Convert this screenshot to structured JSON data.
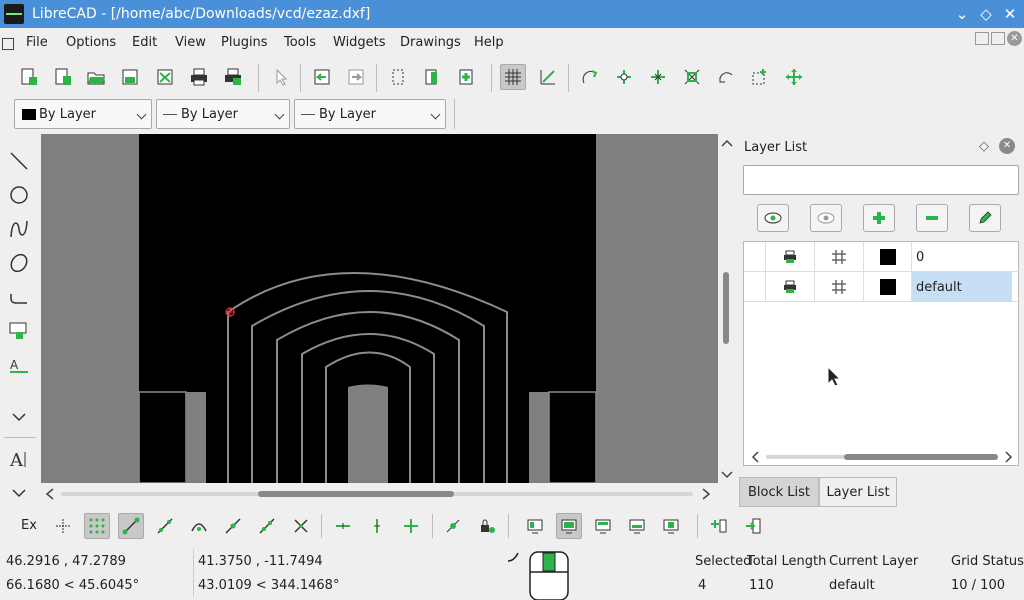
{
  "window": {
    "title": "LibreCAD - [/home/abc/Downloads/vcd/ezaz.dxf]"
  },
  "menu": [
    "File",
    "Options",
    "Edit",
    "View",
    "Plugins",
    "Tools",
    "Widgets",
    "Drawings",
    "Help"
  ],
  "pen_toolbar": {
    "color": "By Layer",
    "line_type": "By Layer",
    "line_width": "By Layer"
  },
  "layer_panel": {
    "title": "Layer List",
    "filter_value": "",
    "layers": [
      {
        "name": "0",
        "color": "#000000",
        "active": false
      },
      {
        "name": "default",
        "color": "#000000",
        "active": true
      }
    ]
  },
  "dock_tabs": [
    "Block List",
    "Layer List"
  ],
  "snap_toolbar": {
    "ex_label": "Ex"
  },
  "status": {
    "abs_coord": "46.2916 , 47.2789",
    "abs_polar": "66.1680 < 45.6045°",
    "rel_coord": "41.3750 , -11.7494",
    "rel_polar": "43.0109 < 344.1468°",
    "selected_label": "Selected",
    "selected_value": "4",
    "total_length_label": "Total Length",
    "total_length_value": "110",
    "current_layer_label": "Current Layer",
    "current_layer_value": "default",
    "grid_status_label": "Grid Status",
    "grid_status_value": "10 / 100"
  },
  "colors": {
    "titlebar": "#4a90d9",
    "canvas_bg": "#000000",
    "drawing_line": "#8c8c8c",
    "selected_row": "#c6dff5",
    "accent_green": "#2db34a"
  }
}
